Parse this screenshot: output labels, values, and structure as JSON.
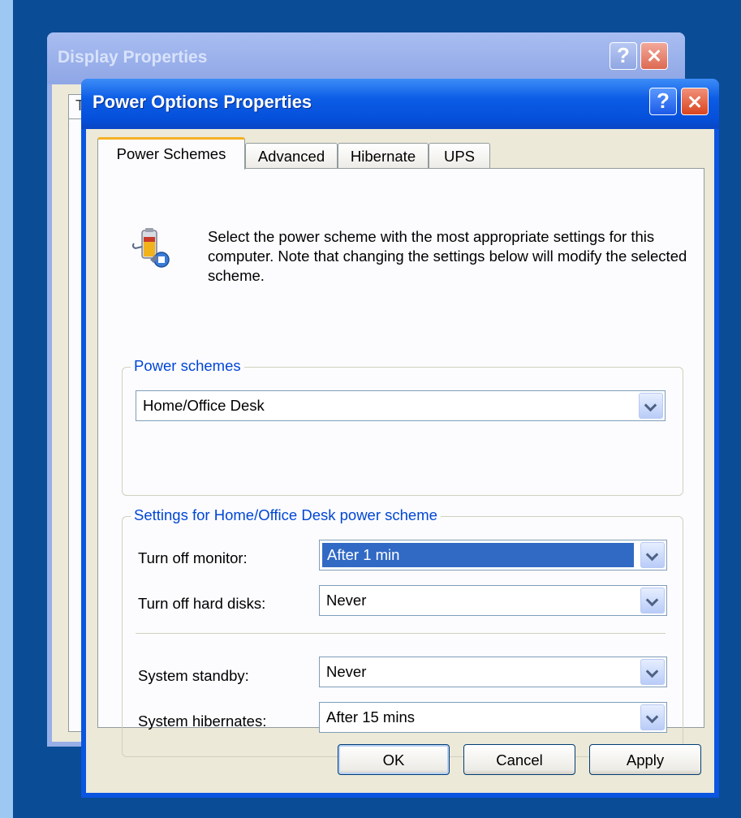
{
  "background_window": {
    "title": "Display Properties",
    "tab_fragment": "T",
    "help_glyph": "?"
  },
  "window": {
    "title": "Power Options Properties",
    "help_glyph": "?"
  },
  "tabs": [
    {
      "label": "Power Schemes"
    },
    {
      "label": "Advanced"
    },
    {
      "label": "Hibernate"
    },
    {
      "label": "UPS"
    }
  ],
  "description": "Select the power scheme with the most appropriate settings for this computer. Note that changing the settings below will modify the selected scheme.",
  "power_schemes": {
    "legend": "Power schemes",
    "selected": "Home/Office Desk"
  },
  "settings": {
    "legend": "Settings for Home/Office Desk power scheme",
    "rows": [
      {
        "label": "Turn off monitor:",
        "value": "After 1 min"
      },
      {
        "label": "Turn off hard disks:",
        "value": "Never"
      },
      {
        "label": "System standby:",
        "value": "Never"
      },
      {
        "label": "System hibernates:",
        "value": "After 15 mins"
      }
    ]
  },
  "buttons": {
    "ok": "OK",
    "cancel": "Cancel",
    "apply": "Apply"
  },
  "colors": {
    "desktop": "#0a4c96",
    "titlebar": "#0c5ce6",
    "group_legend": "#0046d5",
    "selection": "#316ac5",
    "tab_highlight": "#f4b024"
  }
}
